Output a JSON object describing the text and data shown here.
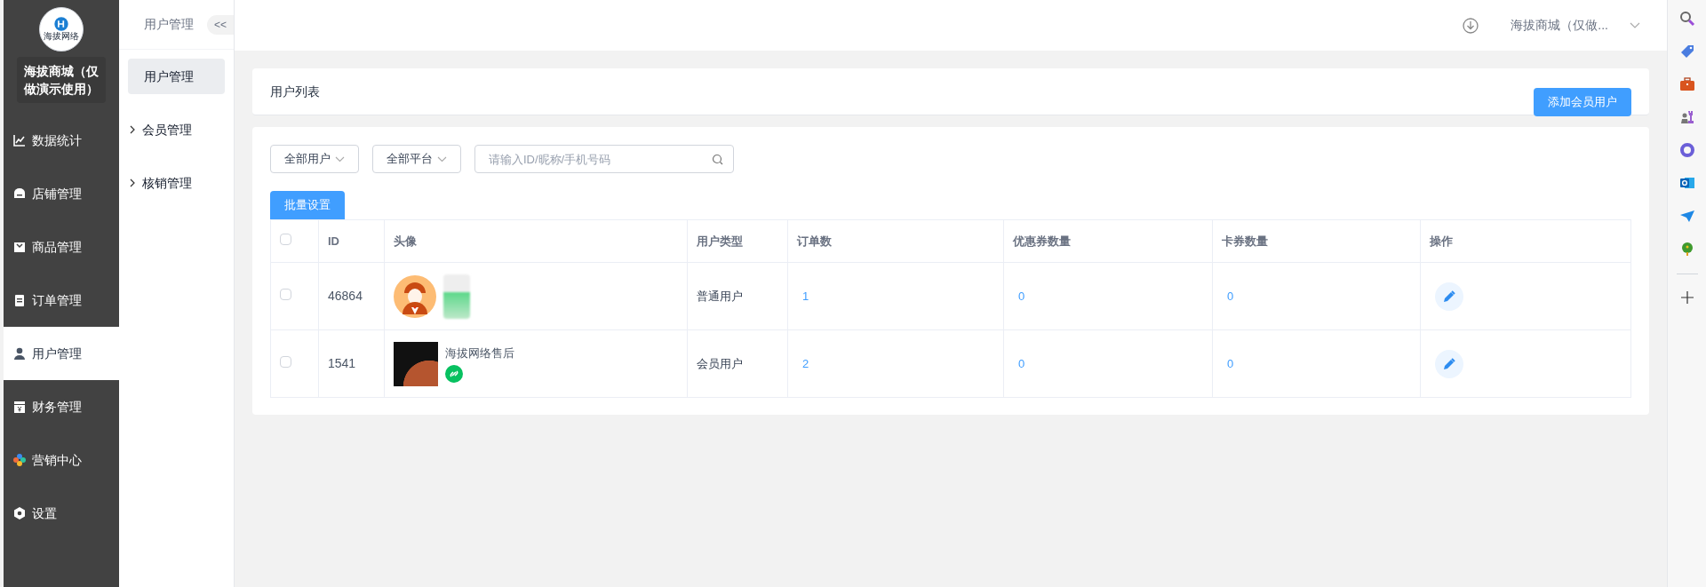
{
  "brand": {
    "logo_text": "海拔网络",
    "name": "海拔商城（仅做演示使用）"
  },
  "nav": [
    {
      "label": "数据统计",
      "selected": false
    },
    {
      "label": "店铺管理",
      "selected": false
    },
    {
      "label": "商品管理",
      "selected": false
    },
    {
      "label": "订单管理",
      "selected": false
    },
    {
      "label": "用户管理",
      "selected": true
    },
    {
      "label": "财务管理",
      "selected": false
    },
    {
      "label": "营销中心",
      "selected": false
    },
    {
      "label": "设置",
      "selected": false
    }
  ],
  "subnav": {
    "title": "用户管理",
    "collapse": "<<",
    "items": [
      {
        "label": "用户管理",
        "kind": "leaf",
        "selected": true
      },
      {
        "label": "会员管理",
        "kind": "group",
        "selected": false
      },
      {
        "label": "核销管理",
        "kind": "group",
        "selected": false
      }
    ]
  },
  "header": {
    "store": "海拔商城（仅做..."
  },
  "list_card": {
    "title": "用户列表",
    "add_button": "添加会员用户"
  },
  "filters": [
    {
      "label": "全部用户"
    },
    {
      "label": "全部平台"
    }
  ],
  "search": {
    "placeholder": "请输入ID/昵称/手机号码"
  },
  "batch_button": "批量设置",
  "table": {
    "header_checked": false,
    "columns": [
      "ID",
      "头像",
      "用户类型",
      "订单数",
      "优惠券数量",
      "卡券数量",
      "操作"
    ],
    "rows": [
      {
        "checked": false,
        "id": "46864",
        "kind": "cartoon",
        "name_obscured": true,
        "type": "普通用户",
        "orders": "1",
        "coupons": "0",
        "cards": "0"
      },
      {
        "checked": false,
        "id": "1541",
        "kind": "photo",
        "name": "海拔网络售后",
        "mini_program": true,
        "type": "会员用户",
        "orders": "2",
        "coupons": "0",
        "cards": "0"
      }
    ]
  }
}
